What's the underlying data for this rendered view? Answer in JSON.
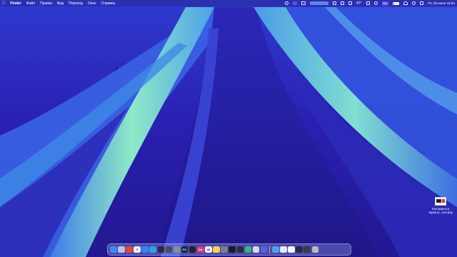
{
  "menubar": {
    "apple_glyph": "",
    "app_name": "Finder",
    "items": [
      "Файл",
      "Правка",
      "Вид",
      "Переход",
      "Окно",
      "Справка"
    ],
    "status": {
      "temperature": "47°",
      "keyboard_layout": "RU",
      "clock": "Пт, 28 июня 16:54"
    }
  },
  "desktop_file": {
    "label_line1": "Как вывести",
    "label_line2": "экран ip...cos.png"
  },
  "dock": {
    "apps": [
      {
        "name": "finder-icon",
        "glyph": "",
        "color": "#3b8df5"
      },
      {
        "name": "launchpad-icon",
        "glyph": "",
        "color": "#b9c4dd"
      },
      {
        "name": "chrome-icon",
        "glyph": "",
        "color": "#e94335"
      },
      {
        "name": "yandex-browser-icon",
        "glyph": "Y",
        "color": "#f2f2f2"
      },
      {
        "name": "safari-icon",
        "glyph": "",
        "color": "#2f86f0"
      },
      {
        "name": "telegram-icon",
        "glyph": "",
        "color": "#2aa4e0"
      },
      {
        "name": "obs-icon",
        "glyph": "",
        "color": "#2c2c34"
      },
      {
        "name": "screenshot-icon",
        "glyph": "",
        "color": "#4b4b55"
      },
      {
        "name": "gear-icon",
        "glyph": "",
        "color": "#8a8d95"
      },
      {
        "name": "photoshop-icon",
        "glyph": "Ps",
        "color": "#0f2a4a"
      },
      {
        "name": "figma-icon",
        "glyph": "",
        "color": "#222222"
      },
      {
        "name": "dreamweaver-icon",
        "glyph": "Dw",
        "color": "#d9386f"
      },
      {
        "name": "calendar-icon",
        "glyph": "28",
        "color": "#f4f4f4"
      },
      {
        "name": "notes-icon",
        "glyph": "",
        "color": "#f6d44a"
      },
      {
        "name": "system-settings-icon",
        "glyph": "",
        "color": "#7a7f88"
      },
      {
        "name": "terminal-icon",
        "glyph": "",
        "color": "#1c1c1c"
      },
      {
        "name": "phone-icon",
        "glyph": "",
        "color": "#2b2b3a"
      },
      {
        "name": "vpn-icon",
        "glyph": "",
        "color": "#38b86a"
      },
      {
        "name": "photos-icon",
        "glyph": "",
        "color": "#d8d8e8"
      },
      {
        "name": "app-icon",
        "glyph": "",
        "color": "#5566dd"
      }
    ],
    "others": [
      {
        "name": "folder-icon",
        "glyph": "",
        "color": "#4aa3f0"
      },
      {
        "name": "window-thumbnail-icon",
        "glyph": "",
        "color": "#e8e8ee"
      },
      {
        "name": "document-icon",
        "glyph": "",
        "color": "#f5f5f5"
      },
      {
        "name": "image-thumbnail-icon",
        "glyph": "",
        "color": "#2a2a3a"
      },
      {
        "name": "screenshot-thumbnail-icon",
        "glyph": "",
        "color": "#3a3a48"
      },
      {
        "name": "trash-icon",
        "glyph": "",
        "color": "#b7bac4"
      }
    ]
  },
  "colors": {
    "wallpaper_deep": "#231a9e",
    "wallpaper_mid": "#3a56e0",
    "wallpaper_light": "#7fe0c8"
  }
}
